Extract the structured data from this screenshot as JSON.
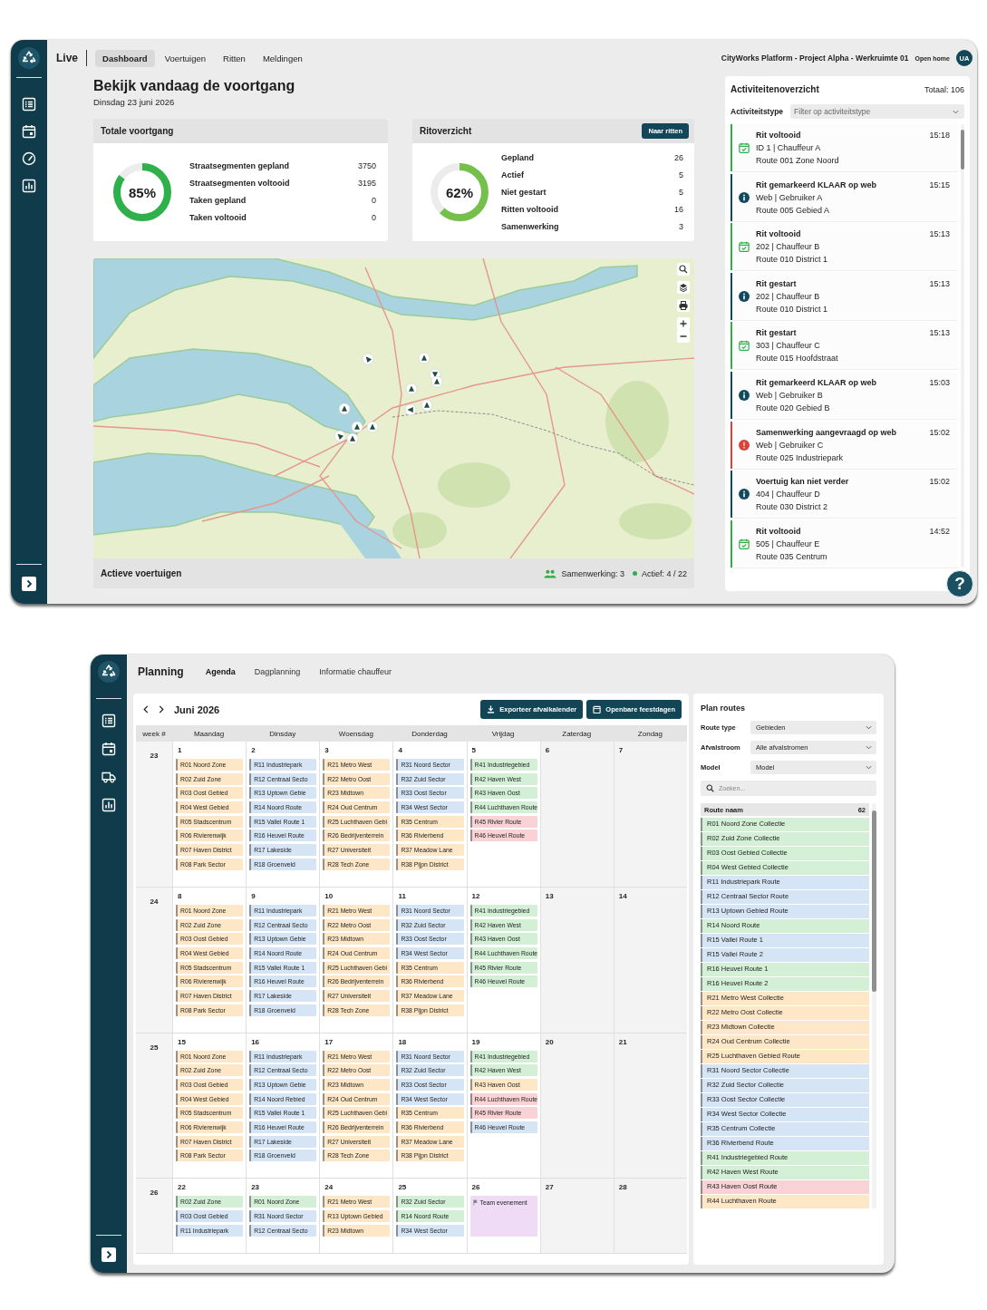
{
  "dashboard": {
    "section": "Live",
    "tabs": [
      {
        "label": "Dashboard",
        "selected": true
      },
      {
        "label": "Voertuigen",
        "selected": false
      },
      {
        "label": "Ritten",
        "selected": false
      },
      {
        "label": "Meldingen",
        "selected": false
      }
    ],
    "workspace": "CityWorks Platform - Project Alpha - Werkruimte 01",
    "home_link": "Open home",
    "avatar": "UA",
    "title": "Bekijk vandaag de voortgang",
    "date": "Dinsdag 23 juni 2026",
    "cards": [
      {
        "kind": "progress",
        "title": "Totale voortgang",
        "percent": "85%",
        "level": 0.85,
        "rows": [
          {
            "label": "Straatsegmenten gepland",
            "value": "3750"
          },
          {
            "label": "Straatsegmenten voltooid",
            "value": "3195"
          },
          {
            "label": "Taken gepland",
            "value": "0"
          },
          {
            "label": "Taken voltooid",
            "value": "0"
          }
        ]
      },
      {
        "kind": "trips",
        "title": "Ritoverzicht",
        "button": "Naar ritten",
        "percent": "62%",
        "level": 0.62,
        "rows": [
          {
            "label": "Gepland",
            "value": "26"
          },
          {
            "label": "Actief",
            "value": "5"
          },
          {
            "label": "Niet gestart",
            "value": "5"
          },
          {
            "label": "Ritten voltooid",
            "value": "16"
          },
          {
            "label": "Samenwerking",
            "value": "3"
          }
        ]
      }
    ],
    "map": {
      "footer_title": "Actieve voertuigen",
      "collaboration": "Samenwerking: 3",
      "active": "Actief: 4 / 22"
    },
    "activity": {
      "title": "Activiteitenoverzicht",
      "total": "Totaal: 106",
      "filter_label": "Activiteitstype",
      "filter": {
        "placeholder": "Filter op activiteitstype"
      },
      "items": [
        {
          "kind": "calendar",
          "title": "Rit voltooid",
          "time": "15:18",
          "lines": [
            "ID 1 | Chauffeur A",
            "Route 001 Zone Noord"
          ]
        },
        {
          "kind": "info",
          "title": "Rit gemarkeerd KLAAR op web",
          "time": "15:15",
          "lines": [
            "Web | Gebruiker A",
            "Route 005 Gebied A"
          ]
        },
        {
          "kind": "calendar",
          "title": "Rit voltooid",
          "time": "15:13",
          "lines": [
            "202 | Chauffeur B",
            "Route 010 District 1"
          ]
        },
        {
          "kind": "info",
          "title": "Rit gestart",
          "time": "15:13",
          "lines": [
            "202 | Chauffeur B",
            "Route 010 District 1"
          ]
        },
        {
          "kind": "calendar",
          "title": "Rit gestart",
          "time": "15:13",
          "lines": [
            "303 | Chauffeur C",
            "Route 015 Hoofdstraat"
          ]
        },
        {
          "kind": "info",
          "title": "Rit gemarkeerd KLAAR op web",
          "time": "15:03",
          "lines": [
            "Web | Gebruiker B",
            "Route 020 Gebied B"
          ]
        },
        {
          "kind": "alert",
          "title": "Samenwerking aangevraagd op web",
          "time": "15:02",
          "lines": [
            "Web | Gebruiker C",
            "Route 025 Industriepark"
          ]
        },
        {
          "kind": "info",
          "title": "Voertuig kan niet verder",
          "time": "15:02",
          "lines": [
            "404 | Chauffeur D",
            "Route 030 District 2"
          ]
        },
        {
          "kind": "calendar",
          "title": "Rit voltooid",
          "time": "14:52",
          "lines": [
            "505 | Chauffeur E",
            "Route 035 Centrum"
          ]
        }
      ]
    },
    "help": "?"
  },
  "planning": {
    "section": "Planning",
    "tabs": [
      {
        "label": "Agenda",
        "selected": true
      },
      {
        "label": "Dagplanning",
        "selected": false
      },
      {
        "label": "Informatie chauffeur",
        "selected": false
      }
    ],
    "month": "Juni 2026",
    "buttons": [
      {
        "kind": "export",
        "label": "Exporteer afvalkalender"
      },
      {
        "kind": "holidays",
        "label": "Openbare feestdagen"
      }
    ],
    "week_header": "week #",
    "columns": [
      {
        "label": "Maandag",
        "weekend": false
      },
      {
        "label": "Dinsday",
        "weekend": false
      },
      {
        "label": "Woensdag",
        "weekend": false
      },
      {
        "label": "Donderdag",
        "weekend": false
      },
      {
        "label": "Vrijdag",
        "weekend": false
      },
      {
        "label": "Zaterdag",
        "weekend": true
      },
      {
        "label": "Zondag",
        "weekend": true
      }
    ],
    "weeks": [
      {
        "week": "23",
        "days": [
          {
            "date": "1",
            "events": [
              {
                "kind": "route",
                "label": "R01 Noord Zone",
                "color": "#fde7c7"
              },
              {
                "kind": "route",
                "label": "R02 Zuid Zone",
                "color": "#fde7c7"
              },
              {
                "kind": "route",
                "label": "R03 Oost Gebied",
                "color": "#fde7c7"
              },
              {
                "kind": "route",
                "label": "R04 West Gebied",
                "color": "#fde7c7"
              },
              {
                "kind": "route",
                "label": "R05 Stadscentrum",
                "color": "#fde7c7"
              },
              {
                "kind": "route",
                "label": "R06 Rivierenwijk",
                "color": "#fde7c7"
              },
              {
                "kind": "route",
                "label": "R07 Haven District",
                "color": "#fde7c7"
              },
              {
                "kind": "route",
                "label": "R08 Park Sector",
                "color": "#fde7c7"
              }
            ]
          },
          {
            "date": "2",
            "events": [
              {
                "kind": "route",
                "label": "R11 Industriepark",
                "color": "#d6e5f5"
              },
              {
                "kind": "route",
                "label": "R12 Centraal Secto",
                "color": "#d6e5f5"
              },
              {
                "kind": "route",
                "label": "R13 Uptown Gebie",
                "color": "#d6e5f5"
              },
              {
                "kind": "route",
                "label": "R14 Noord Route",
                "color": "#d6e5f5"
              },
              {
                "kind": "route",
                "label": "R15 Vallei Route 1",
                "color": "#d6e5f5"
              },
              {
                "kind": "route",
                "label": "R16 Heuvel Route",
                "color": "#d6e5f5"
              },
              {
                "kind": "route",
                "label": "R17 Lakeside",
                "color": "#d6e5f5"
              },
              {
                "kind": "route",
                "label": "R18 Groenveld",
                "color": "#d6e5f5"
              }
            ]
          },
          {
            "date": "3",
            "events": [
              {
                "kind": "route",
                "label": "R21 Metro West",
                "color": "#fde7c7"
              },
              {
                "kind": "route",
                "label": "R22 Metro Oost",
                "color": "#fde7c7"
              },
              {
                "kind": "route",
                "label": "R23 Midtown",
                "color": "#fde7c7"
              },
              {
                "kind": "route",
                "label": "R24 Oud Centrum",
                "color": "#fde7c7"
              },
              {
                "kind": "route",
                "label": "R25 Luchthaven Gebi",
                "color": "#fde7c7"
              },
              {
                "kind": "route",
                "label": "R26 Bedrijventerrein",
                "color": "#fde7c7"
              },
              {
                "kind": "route",
                "label": "R27 Universiteit",
                "color": "#fde7c7"
              },
              {
                "kind": "route",
                "label": "R28 Tech Zone",
                "color": "#fde7c7"
              }
            ]
          },
          {
            "date": "4",
            "events": [
              {
                "kind": "route",
                "label": "R31 Noord Sector",
                "color": "#d6e5f5"
              },
              {
                "kind": "route",
                "label": "R32 Zuid Sector",
                "color": "#d6e5f5"
              },
              {
                "kind": "route",
                "label": "R33 Oost Sector",
                "color": "#d6e5f5"
              },
              {
                "kind": "route",
                "label": "R34 West Sector",
                "color": "#d6e5f5"
              },
              {
                "kind": "route",
                "label": "R35 Centrum",
                "color": "#fde7c7"
              },
              {
                "kind": "route",
                "label": "R36 Rivierbend",
                "color": "#fde7c7"
              },
              {
                "kind": "route",
                "label": "R37 Meadow Lane",
                "color": "#fde7c7"
              },
              {
                "kind": "route",
                "label": "R38 Pijpn District",
                "color": "#fde7c7"
              }
            ]
          },
          {
            "date": "5",
            "events": [
              {
                "kind": "route",
                "label": "R41 Industriegebied",
                "color": "#d3f0d7"
              },
              {
                "kind": "route",
                "label": "R42 Haven West",
                "color": "#d3f0d7"
              },
              {
                "kind": "route",
                "label": "R43 Haven Oost",
                "color": "#d3f0d7"
              },
              {
                "kind": "route",
                "label": "R44 Luchthaven Route",
                "color": "#d3f0d7"
              },
              {
                "kind": "route",
                "label": "R45 Rivier Route",
                "color": "#f8d2d5"
              },
              {
                "kind": "route",
                "label": "R46 Heuvel Route",
                "color": "#f8d2d5"
              }
            ]
          },
          {
            "date": "6"
          },
          {
            "date": "7"
          }
        ]
      },
      {
        "week": "24",
        "days": [
          {
            "date": "8",
            "events": [
              {
                "kind": "route",
                "label": "R01 Noord Zone",
                "color": "#fde7c7"
              },
              {
                "kind": "route",
                "label": "R02 Zuid Zone",
                "color": "#fde7c7"
              },
              {
                "kind": "route",
                "label": "R03 Oost Gebied",
                "color": "#fde7c7"
              },
              {
                "kind": "route",
                "label": "R04 West Gebied",
                "color": "#fde7c7"
              },
              {
                "kind": "route",
                "label": "R05 Stadscentrum",
                "color": "#fde7c7"
              },
              {
                "kind": "route",
                "label": "R06 Rivierenwijk",
                "color": "#fde7c7"
              },
              {
                "kind": "route",
                "label": "R07 Haven District",
                "color": "#fde7c7"
              },
              {
                "kind": "route",
                "label": "R08 Park Sector",
                "color": "#fde7c7"
              }
            ]
          },
          {
            "date": "9",
            "events": [
              {
                "kind": "route",
                "label": "R11 Industriepark",
                "color": "#d6e5f5"
              },
              {
                "kind": "route",
                "label": "R12 Centraal Secto",
                "color": "#d6e5f5"
              },
              {
                "kind": "route",
                "label": "R13 Uptown Gebie",
                "color": "#d6e5f5"
              },
              {
                "kind": "route",
                "label": "R14 Noord Route",
                "color": "#d6e5f5"
              },
              {
                "kind": "route",
                "label": "R15 Vallei Route 1",
                "color": "#d6e5f5"
              },
              {
                "kind": "route",
                "label": "R16 Heuvel Route",
                "color": "#d6e5f5"
              },
              {
                "kind": "route",
                "label": "R17 Lakeside",
                "color": "#d6e5f5"
              },
              {
                "kind": "route",
                "label": "R18 Groenveld",
                "color": "#d6e5f5"
              }
            ]
          },
          {
            "date": "10",
            "events": [
              {
                "kind": "route",
                "label": "R21 Metro West",
                "color": "#fde7c7"
              },
              {
                "kind": "route",
                "label": "R22 Metro Oost",
                "color": "#fde7c7"
              },
              {
                "kind": "route",
                "label": "R23 Midtown",
                "color": "#fde7c7"
              },
              {
                "kind": "route",
                "label": "R24 Oud Centrum",
                "color": "#fde7c7"
              },
              {
                "kind": "route",
                "label": "R25 Luchthaven Gebi",
                "color": "#fde7c7"
              },
              {
                "kind": "route",
                "label": "R26 Bedrijventerrein",
                "color": "#fde7c7"
              },
              {
                "kind": "route",
                "label": "R27 Universiteit",
                "color": "#fde7c7"
              },
              {
                "kind": "route",
                "label": "R28 Tech Zone",
                "color": "#fde7c7"
              }
            ]
          },
          {
            "date": "11",
            "events": [
              {
                "kind": "route",
                "label": "R31 Noord Sector",
                "color": "#d6e5f5"
              },
              {
                "kind": "route",
                "label": "R32 Zuid Sector",
                "color": "#d6e5f5"
              },
              {
                "kind": "route",
                "label": "R33 Oost Sector",
                "color": "#d6e5f5"
              },
              {
                "kind": "route",
                "label": "R34 West Sector",
                "color": "#d6e5f5"
              },
              {
                "kind": "route",
                "label": "R35 Centrum",
                "color": "#fde7c7"
              },
              {
                "kind": "route",
                "label": "R36 Rivierbend",
                "color": "#fde7c7"
              },
              {
                "kind": "route",
                "label": "R37 Meadow Lane",
                "color": "#fde7c7"
              },
              {
                "kind": "route",
                "label": "R38 Pijpn District",
                "color": "#fde7c7"
              }
            ]
          },
          {
            "date": "12",
            "events": [
              {
                "kind": "route",
                "label": "R41 Industriegebied",
                "color": "#d3f0d7"
              },
              {
                "kind": "route",
                "label": "R42 Haven West",
                "color": "#d3f0d7"
              },
              {
                "kind": "route",
                "label": "R43 Haven Oost",
                "color": "#d3f0d7"
              },
              {
                "kind": "route",
                "label": "R44 Luchthaven Route",
                "color": "#d3f0d7"
              },
              {
                "kind": "route",
                "label": "R45 Rivier Route",
                "color": "#d3f0d7"
              },
              {
                "kind": "route",
                "label": "R46 Heuvel Route",
                "color": "#d3f0d7"
              }
            ]
          },
          {
            "date": "13"
          },
          {
            "date": "14"
          }
        ]
      },
      {
        "week": "25",
        "days": [
          {
            "date": "15",
            "events": [
              {
                "kind": "route",
                "label": "R01 Noord Zone",
                "color": "#fde7c7"
              },
              {
                "kind": "route",
                "label": "R02 Zuid Zone",
                "color": "#fde7c7"
              },
              {
                "kind": "route",
                "label": "R03 Oost Gebied",
                "color": "#fde7c7"
              },
              {
                "kind": "route",
                "label": "R04 West Gebied",
                "color": "#fde7c7"
              },
              {
                "kind": "route",
                "label": "R05 Stadscentrum",
                "color": "#fde7c7"
              },
              {
                "kind": "route",
                "label": "R06 Rivierenwijk",
                "color": "#fde7c7"
              },
              {
                "kind": "route",
                "label": "R07 Haven District",
                "color": "#fde7c7"
              },
              {
                "kind": "route",
                "label": "R08 Park Sector",
                "color": "#fde7c7"
              }
            ]
          },
          {
            "date": "16",
            "events": [
              {
                "kind": "route",
                "label": "R11 Industriepark",
                "color": "#d6e5f5"
              },
              {
                "kind": "route",
                "label": "R12 Centraal Secto",
                "color": "#d6e5f5"
              },
              {
                "kind": "route",
                "label": "R13 Uptown Gebie",
                "color": "#d6e5f5"
              },
              {
                "kind": "route",
                "label": "R14 Noord Rebied",
                "color": "#d6e5f5"
              },
              {
                "kind": "route",
                "label": "R15 Vallei Route 1",
                "color": "#d6e5f5"
              },
              {
                "kind": "route",
                "label": "R16 Heuvel Route",
                "color": "#d6e5f5"
              },
              {
                "kind": "route",
                "label": "R17 Lakeside",
                "color": "#d6e5f5"
              },
              {
                "kind": "route",
                "label": "R18 Groenveld",
                "color": "#d6e5f5"
              }
            ]
          },
          {
            "date": "17",
            "events": [
              {
                "kind": "route",
                "label": "R21 Metro West",
                "color": "#fde7c7"
              },
              {
                "kind": "route",
                "label": "R22 Metro Oost",
                "color": "#fde7c7"
              },
              {
                "kind": "route",
                "label": "R23 Midtown",
                "color": "#fde7c7"
              },
              {
                "kind": "route",
                "label": "R24 Oud Centrum",
                "color": "#fde7c7"
              },
              {
                "kind": "route",
                "label": "R25 Luchthaven Gebi",
                "color": "#fde7c7"
              },
              {
                "kind": "route",
                "label": "R26 Bedrijventerrein",
                "color": "#fde7c7"
              },
              {
                "kind": "route",
                "label": "R27 Universiteit",
                "color": "#fde7c7"
              },
              {
                "kind": "route",
                "label": "R28 Tech Zone",
                "color": "#fde7c7"
              }
            ]
          },
          {
            "date": "18",
            "events": [
              {
                "kind": "route",
                "label": "R31 Noord Sector",
                "color": "#d6e5f5"
              },
              {
                "kind": "route",
                "label": "R32 Zuid Sector",
                "color": "#d6e5f5"
              },
              {
                "kind": "route",
                "label": "R33 Oost Sector",
                "color": "#d6e5f5"
              },
              {
                "kind": "route",
                "label": "R34 West Sector",
                "color": "#d6e5f5"
              },
              {
                "kind": "route",
                "label": "R35 Centrum",
                "color": "#fde7c7"
              },
              {
                "kind": "route",
                "label": "R36 Rivierbend",
                "color": "#fde7c7"
              },
              {
                "kind": "route",
                "label": "R37 Meadow Lane",
                "color": "#fde7c7"
              },
              {
                "kind": "route",
                "label": "R38 Pijpn District",
                "color": "#fde7c7"
              }
            ]
          },
          {
            "date": "19",
            "events": [
              {
                "kind": "route",
                "label": "R41 Industriegebied",
                "color": "#d3f0d7"
              },
              {
                "kind": "route",
                "label": "R42 Haven West",
                "color": "#d3f0d7"
              },
              {
                "kind": "route",
                "label": "R43 Haven Oost",
                "color": "#fde7c7"
              },
              {
                "kind": "route",
                "label": "R44 Luchthaven Route",
                "color": "#f8d2d5"
              },
              {
                "kind": "route",
                "label": "R45 Rivier Route",
                "color": "#f8d2d5"
              },
              {
                "kind": "route",
                "label": "R46 Heuvel Route",
                "color": "#d6e5f5"
              }
            ]
          },
          {
            "date": "20"
          },
          {
            "date": "21"
          }
        ]
      },
      {
        "week": "26",
        "days": [
          {
            "date": "22",
            "events": [
              {
                "kind": "route",
                "label": "R02 Zuid Zone",
                "color": "#d3f0d7"
              },
              {
                "kind": "route",
                "label": "R03 Oost Gebied",
                "color": "#d6e5f5"
              },
              {
                "kind": "route",
                "label": "R11 Industriepark",
                "color": "#d6e5f5"
              }
            ]
          },
          {
            "date": "23",
            "events": [
              {
                "kind": "route",
                "label": "R01 Noord Zone",
                "color": "#d3f0d7"
              },
              {
                "kind": "route",
                "label": "R31 Noord Sector",
                "color": "#d6e5f5"
              },
              {
                "kind": "route",
                "label": "R12 Centraal Secto",
                "color": "#d6e5f5"
              }
            ]
          },
          {
            "date": "24",
            "events": [
              {
                "kind": "route",
                "label": "R21 Metro West",
                "color": "#fde7c7"
              },
              {
                "kind": "route",
                "label": "R13 Uptown Gebied",
                "color": "#fde7c7"
              },
              {
                "kind": "route",
                "label": "R23 Midtown",
                "color": "#fde7c7"
              }
            ]
          },
          {
            "date": "25",
            "events": [
              {
                "kind": "route",
                "label": "R32 Zuid Sector",
                "color": "#d3f0d7"
              },
              {
                "kind": "route",
                "label": "R14 Noord Route",
                "color": "#d3f0d7"
              },
              {
                "kind": "route",
                "label": "R34 West Sector",
                "color": "#d6e5f5"
              }
            ]
          },
          {
            "date": "26",
            "events": [
              {
                "kind": "event",
                "label": "Team evenement",
                "color": "#f0dbf6"
              }
            ]
          },
          {
            "date": "27"
          },
          {
            "date": "28"
          }
        ]
      }
    ],
    "routes_panel": {
      "title": "Plan routes",
      "filters": [
        {
          "label": "Route type",
          "value": "Gebieden"
        },
        {
          "label": "Afvalstroom",
          "value": "Alle afvalstromen"
        },
        {
          "label": "Model",
          "value": "Model"
        }
      ],
      "search": {
        "placeholder": "Zoeken..."
      },
      "list_header": "Route naam",
      "count": "62",
      "routes": [
        {
          "label": "R01 Noord Zone Collectie",
          "color": "#d3f0d7"
        },
        {
          "label": "R02 Zuid Zone Collectie",
          "color": "#d3f0d7"
        },
        {
          "label": "R03 Oost Gebied Collectie",
          "color": "#d3f0d7"
        },
        {
          "label": "R04 West Gebied Collectie",
          "color": "#d3f0d7"
        },
        {
          "label": "R11 Industriepark Route",
          "color": "#d6e5f5"
        },
        {
          "label": "R12 Centraal Sector Route",
          "color": "#d6e5f5"
        },
        {
          "label": "R13 Uptown Gebied Route",
          "color": "#d6e5f5"
        },
        {
          "label": "R14 Noord Route",
          "color": "#d3f0d7"
        },
        {
          "label": "R15 Vallei Route 1",
          "color": "#d6e5f5"
        },
        {
          "label": "R15 Vallei Route 2",
          "color": "#d6e5f5"
        },
        {
          "label": "R16 Heuvel Route 1",
          "color": "#d3f0d7"
        },
        {
          "label": "R16 Heuvel Route 2",
          "color": "#d3f0d7"
        },
        {
          "label": "R21 Metro West Collectie",
          "color": "#fde7c7"
        },
        {
          "label": "R22 Metro Oost Collectie",
          "color": "#fde7c7"
        },
        {
          "label": "R23 Midtown Collectie",
          "color": "#fde7c7"
        },
        {
          "label": "R24 Oud Centrum Collectie",
          "color": "#fde7c7"
        },
        {
          "label": "R25 Luchthaven Gebied Route",
          "color": "#fde7c7"
        },
        {
          "label": "R31 Noord Sector Collectie",
          "color": "#d6e5f5"
        },
        {
          "label": "R32 Zuid Sector Collectie",
          "color": "#d6e5f5"
        },
        {
          "label": "R33 Oost Sector Collectie",
          "color": "#d6e5f5"
        },
        {
          "label": "R34 West Sector Collectie",
          "color": "#d6e5f5"
        },
        {
          "label": "R35 Centrum Collectie",
          "color": "#d6e5f5"
        },
        {
          "label": "R36 Rivierbend Route",
          "color": "#d6e5f5"
        },
        {
          "label": "R41 Industriegebied Route",
          "color": "#d3f0d7"
        },
        {
          "label": "R42 Haven West Route",
          "color": "#d3f0d7"
        },
        {
          "label": "R43 Haven Oost Route",
          "color": "#f8d2d5"
        },
        {
          "label": "R44 Luchthaven Route",
          "color": "#fde7c7"
        }
      ]
    }
  }
}
